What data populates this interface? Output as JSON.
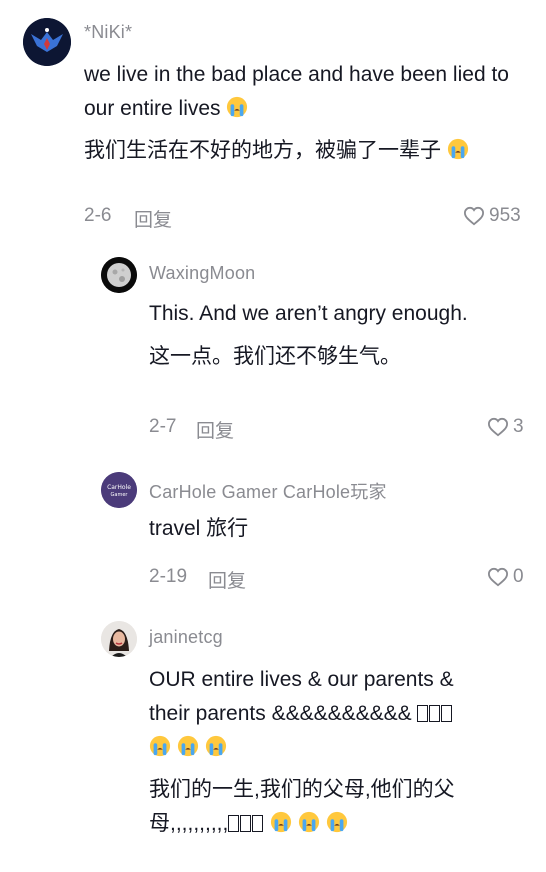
{
  "comments": [
    {
      "username": "*NiKi*",
      "text_en": "we live in the bad place and have been lied to our entire lives",
      "text_zh": "我们生活在不好的地方，被骗了一辈子",
      "date": "2-6",
      "reply_label": "回复",
      "likes": "953",
      "avatar_icon": "winged-emblem-avatar"
    },
    {
      "username": "WaxingMoon",
      "text_en": "This. And we aren’t angry enough.",
      "text_zh": "这一点。我们还不够生气。",
      "date": "2-7",
      "reply_label": "回复",
      "likes": "3",
      "avatar_icon": "moon-avatar"
    },
    {
      "username": "CarHole Gamer CarHole玩家",
      "text": "travel 旅行",
      "date": "2-19",
      "reply_label": "回复",
      "likes": "0",
      "avatar_icon": "carhole-logo-avatar",
      "avatar_text": "CarHole Gamer"
    },
    {
      "username": "janinetcg",
      "text_en_line1": "OUR entire lives & our parents &",
      "text_en_line2": "their parents &&&&&&&&&&",
      "text_zh_line1": "我们的一生,我们的父母,他们的父",
      "text_zh_line2": "母,,,,,,,,,,",
      "avatar_icon": "woman-portrait-avatar"
    }
  ],
  "colors": {
    "text": "#161823",
    "muted": "#8a8b91",
    "emoji": "#ffc83d"
  }
}
